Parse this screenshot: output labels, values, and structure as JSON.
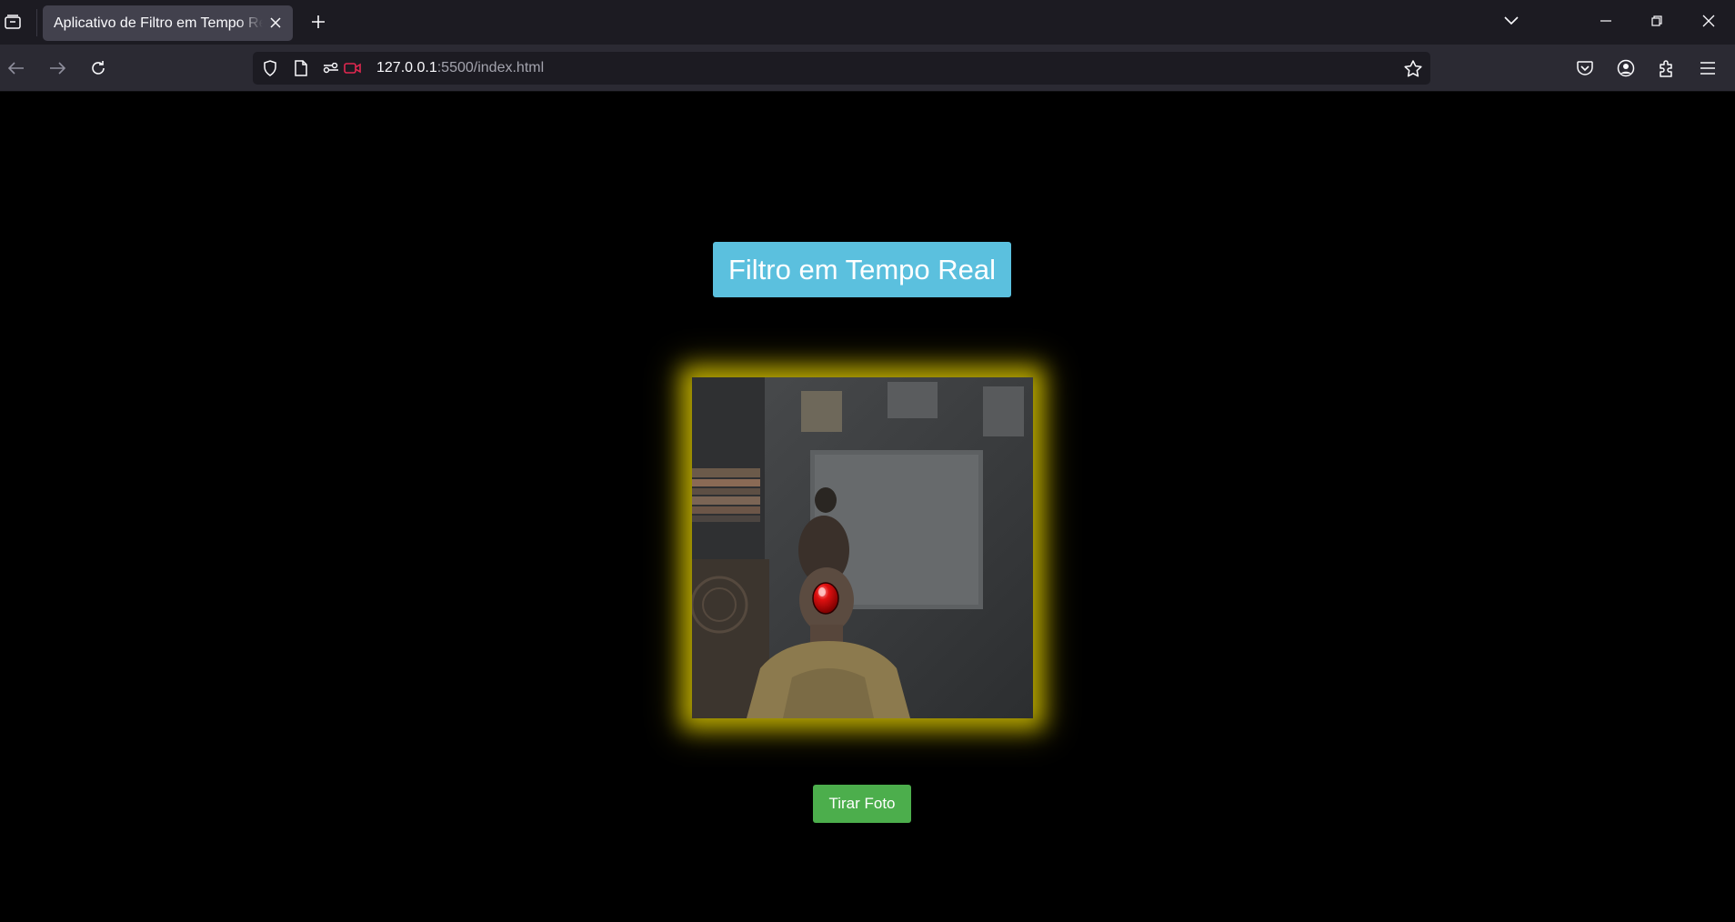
{
  "browser": {
    "tab_title": "Aplicativo de Filtro em Tempo Real",
    "url_host": "127.0.0.1",
    "url_path": ":5500/index.html"
  },
  "page": {
    "title": "Filtro em Tempo Real",
    "photo_button": "Tirar Foto"
  },
  "colors": {
    "title_bg": "#5bc0de",
    "button_bg": "#4cae4c",
    "glow": "#b3a300",
    "page_bg": "#000000"
  }
}
